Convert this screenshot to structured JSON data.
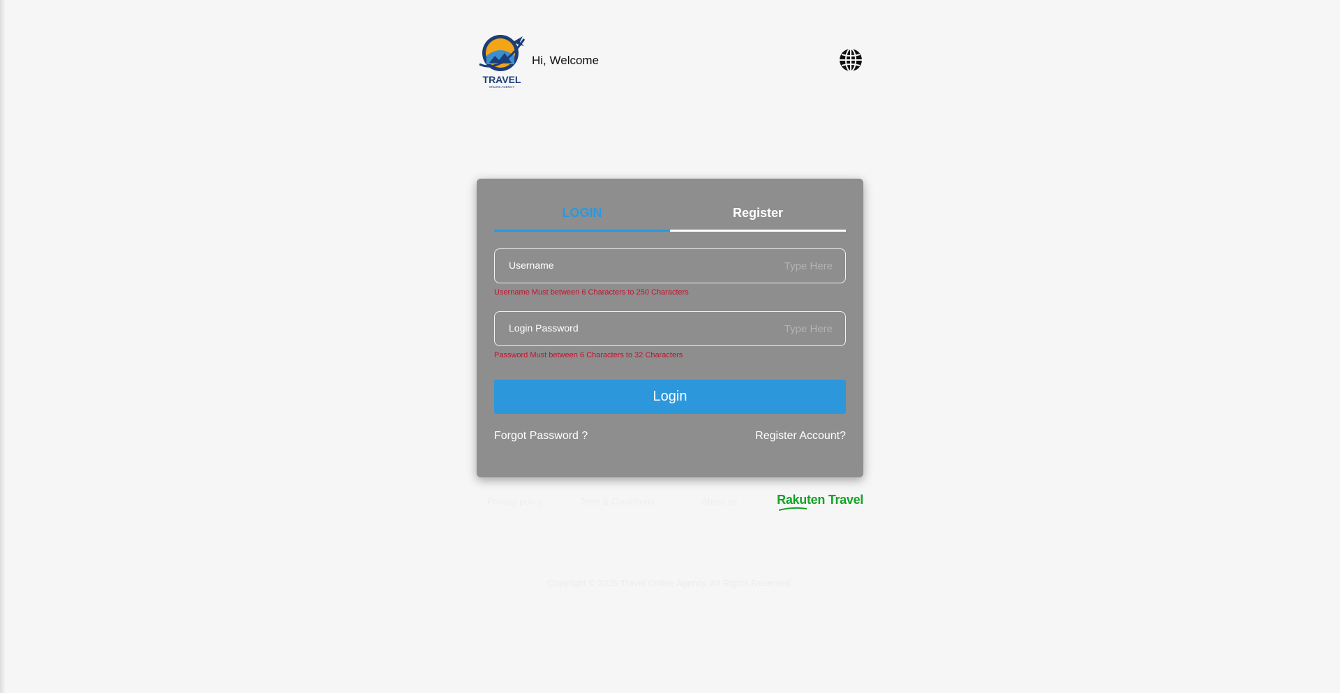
{
  "header": {
    "logo_text": "TRAVEL",
    "logo_subtext": "ONLINE AGENCY",
    "welcome": "Hi, Welcome",
    "language_icon": "globe-icon"
  },
  "tabs": [
    {
      "label": "LOGIN",
      "active": true
    },
    {
      "label": "Register",
      "active": false
    }
  ],
  "form": {
    "username_label": "Username",
    "username_placeholder": "Type Here",
    "username_error": "Username Must between 6 Characters to 250 Characters",
    "password_label": "Login Password",
    "password_placeholder": "Type Here",
    "password_error": "Password Must between 6 Characters to 32 Characters",
    "login_button": "Login",
    "forgot_link": "Forgot Password ?",
    "register_link": "Register Account?"
  },
  "footer": {
    "links": [
      "Privacy policy",
      "Term & Conditions",
      "About us"
    ],
    "partner_logo": "Rakuten Travel",
    "copyright": "Copyright © 2025 Travel Online Agency. All Rights Reserved."
  },
  "colors": {
    "accent": "#2a98df",
    "card": "#8e8e8e",
    "error": "#c8102e",
    "partner": "#12a325"
  }
}
